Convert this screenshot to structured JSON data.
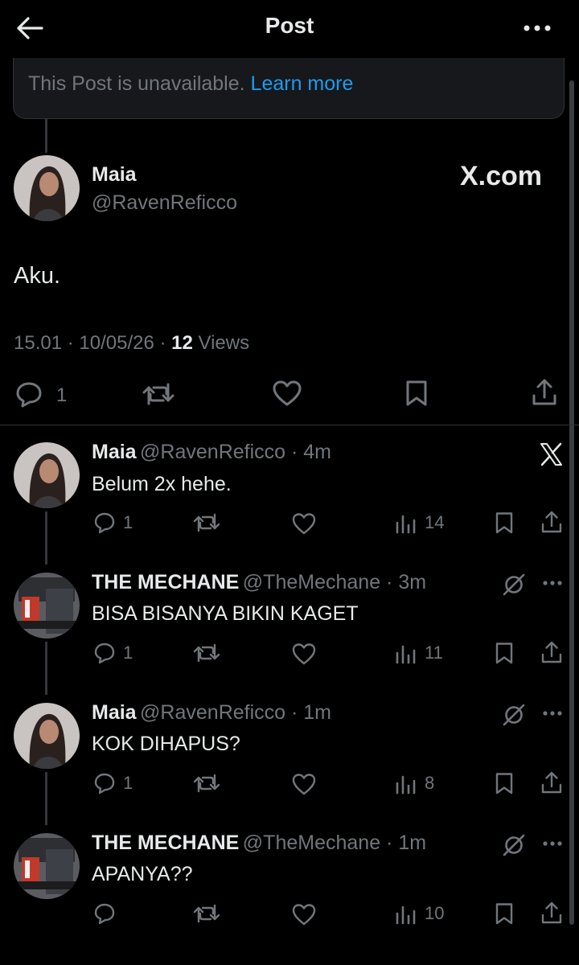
{
  "header": {
    "title": "Post"
  },
  "notice": {
    "text": "This Post is unavailable.",
    "link": "Learn more"
  },
  "main_post": {
    "name": "Maia",
    "handle": "@RavenReficco",
    "watermark": "X.com",
    "text": "Aku.",
    "time": "15.01",
    "date": "10/05/26",
    "views_count": "12",
    "views_label": "Views",
    "replies": "1"
  },
  "replies": [
    {
      "name": "Maia",
      "handle": "@RavenReficco",
      "time": "4m",
      "text": "Belum 2x hehe.",
      "reply_count": "1",
      "views": "14",
      "avatar": "maia"
    },
    {
      "name": "THE MECHANE",
      "handle": "@TheMechane",
      "time": "3m",
      "text": "BISA BISANYA BIKIN KAGET",
      "reply_count": "1",
      "views": "11",
      "avatar": "mechane"
    },
    {
      "name": "Maia",
      "handle": "@RavenReficco",
      "time": "1m",
      "text": "KOK DIHAPUS?",
      "reply_count": "1",
      "views": "8",
      "avatar": "maia"
    },
    {
      "name": "THE MECHANE",
      "handle": "@TheMechane",
      "time": "1m",
      "text": "APANYA??",
      "reply_count": "",
      "views": "10",
      "avatar": "mechane"
    }
  ],
  "colors": {
    "background": "#000000",
    "text": "#e7e9ea",
    "muted": "#71767b",
    "link": "#1d9bf0",
    "border": "#2f3336"
  }
}
